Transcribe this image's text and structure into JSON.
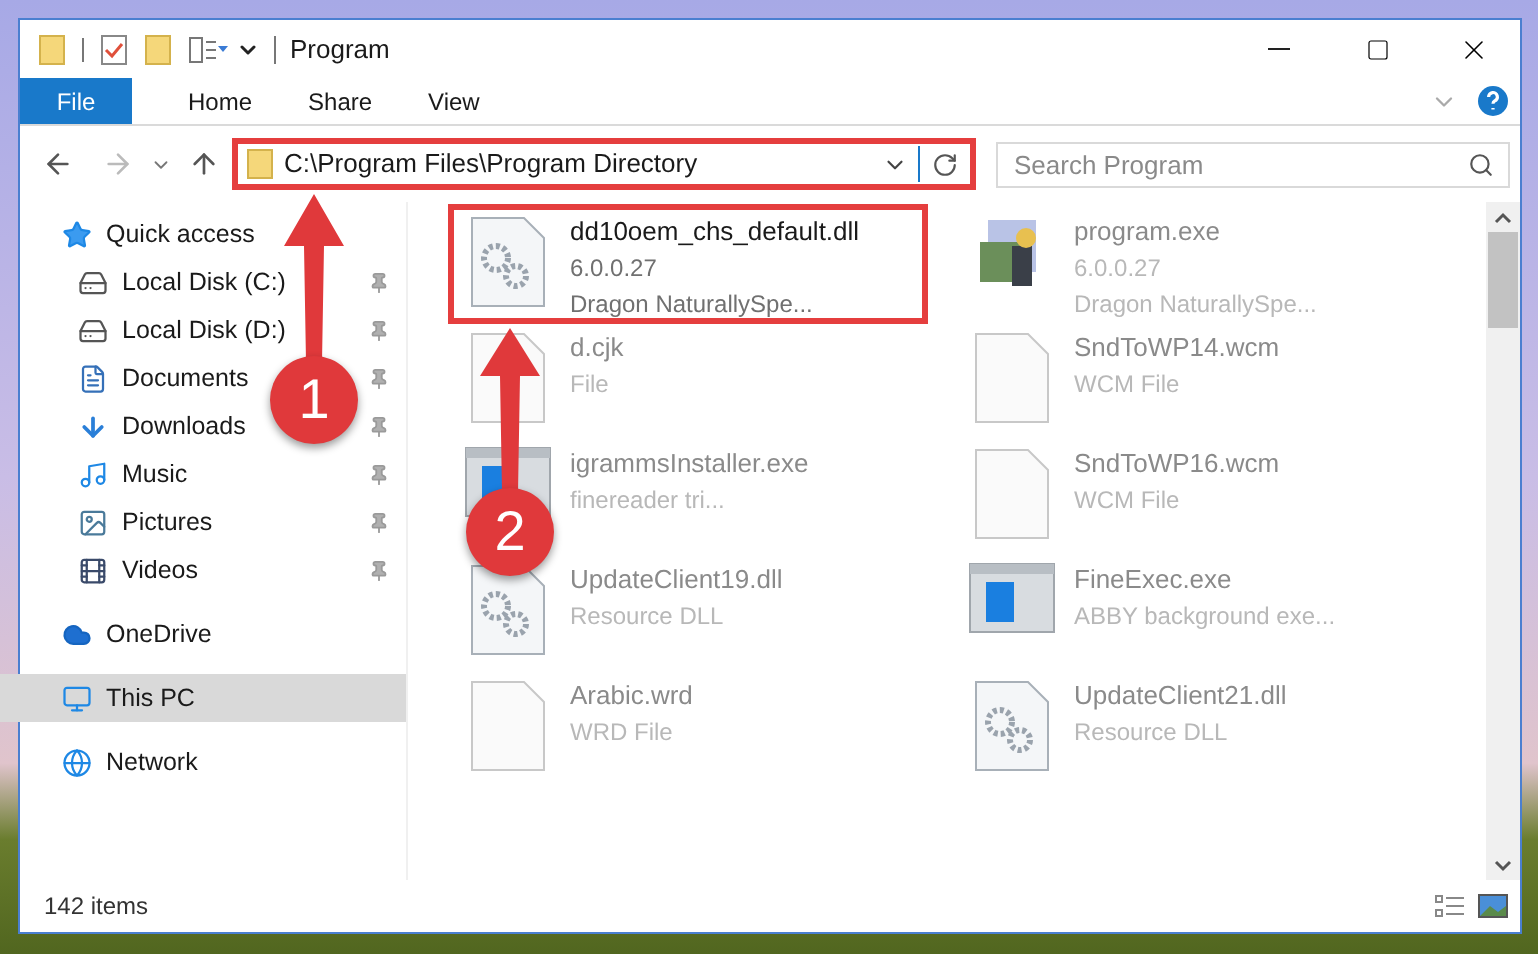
{
  "window": {
    "title": "Program"
  },
  "ribbon_tabs": [
    {
      "label": "File",
      "kind": "file",
      "selected": false
    },
    {
      "label": "Home",
      "kind": "tab",
      "selected": false
    },
    {
      "label": "Share",
      "kind": "tab",
      "selected": false
    },
    {
      "label": "View",
      "kind": "tab",
      "selected": false
    }
  ],
  "address": {
    "path": "C:\\Program Files\\Program Directory"
  },
  "search": {
    "placeholder": "Search Program"
  },
  "sidebar": {
    "items": [
      {
        "label": "Quick access",
        "kind": "star",
        "selected": false,
        "children": [
          {
            "label": "Local Disk (C:)",
            "kind": "disk",
            "selected": false,
            "pinned": true
          },
          {
            "label": "Local Disk (D:)",
            "kind": "disk",
            "selected": false,
            "pinned": true
          },
          {
            "label": "Documents",
            "kind": "document",
            "selected": false,
            "pinned": true
          },
          {
            "label": "Downloads",
            "kind": "download",
            "selected": false,
            "pinned": true
          },
          {
            "label": "Music",
            "kind": "music",
            "selected": false,
            "pinned": true
          },
          {
            "label": "Pictures",
            "kind": "pictures",
            "selected": false,
            "pinned": true
          },
          {
            "label": "Videos",
            "kind": "videos",
            "selected": false,
            "pinned": true
          }
        ]
      },
      {
        "label": "OneDrive",
        "kind": "cloud",
        "selected": false
      },
      {
        "label": "This PC",
        "kind": "pc",
        "selected": true
      },
      {
        "label": "Network",
        "kind": "network",
        "selected": false
      }
    ]
  },
  "files": [
    {
      "name": "dd10oem_chs_default.dll",
      "details": [
        "6.0.0.27",
        "Dragon NaturallySpe..."
      ],
      "kind": "dll",
      "highlighted": true
    },
    {
      "name": "program.exe",
      "details": [
        "6.0.0.27",
        "Dragon NaturallySpe..."
      ],
      "kind": "app",
      "highlighted": false
    },
    {
      "name": "d.cjk",
      "details": [
        "File"
      ],
      "kind": "doc",
      "highlighted": false
    },
    {
      "name": "SndToWP14.wcm",
      "details": [
        "WCM File"
      ],
      "kind": "doc",
      "highlighted": false
    },
    {
      "name": "igrammsInstaller.exe",
      "details": [
        "finereader tri..."
      ],
      "kind": "window",
      "highlighted": false
    },
    {
      "name": "SndToWP16.wcm",
      "details": [
        "WCM File"
      ],
      "kind": "doc",
      "highlighted": false
    },
    {
      "name": "UpdateClient19.dll",
      "details": [
        "Resource DLL"
      ],
      "kind": "dll",
      "highlighted": false
    },
    {
      "name": "FineExec.exe",
      "details": [
        "ABBY background exe..."
      ],
      "kind": "window",
      "highlighted": false
    },
    {
      "name": "Arabic.wrd",
      "details": [
        "WRD File"
      ],
      "kind": "doc",
      "highlighted": false
    },
    {
      "name": "UpdateClient21.dll",
      "details": [
        "Resource DLL"
      ],
      "kind": "dll",
      "highlighted": false
    }
  ],
  "status_bar": {
    "item_count": "142 items"
  },
  "annotations": [
    {
      "label": "1"
    },
    {
      "label": "2"
    }
  ]
}
